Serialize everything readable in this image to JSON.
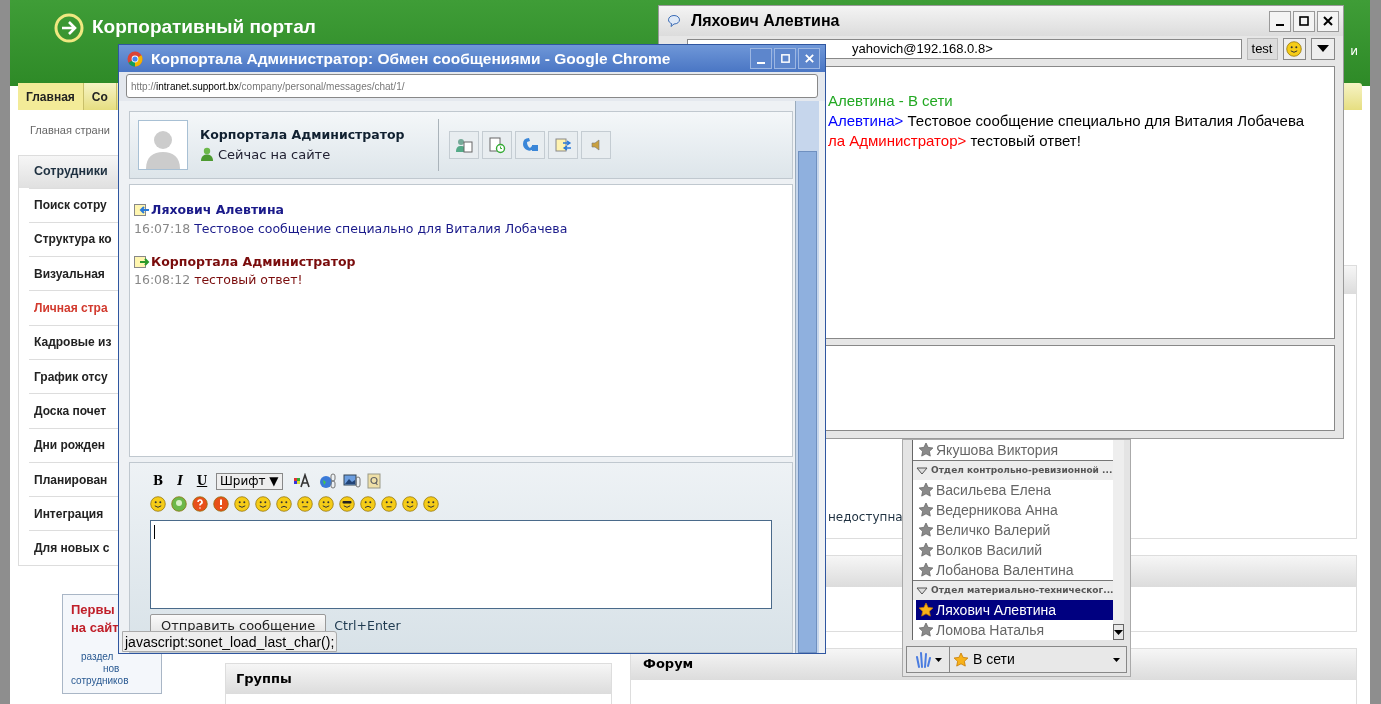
{
  "portal": {
    "title": "Корпоративный портал",
    "top_right_fragment": "и",
    "nav": [
      {
        "label": "Главная",
        "selected": true
      },
      {
        "label": "Со",
        "selected": false
      }
    ],
    "breadcrumb": "Главная страни",
    "sidebar": {
      "title": "Сотрудники",
      "items": [
        {
          "label": "Поиск сотру",
          "selected": false
        },
        {
          "label": "Структура ко",
          "selected": false
        },
        {
          "label": "Визуальная",
          "selected": false
        },
        {
          "label": "Личная стра",
          "selected": true
        },
        {
          "label": "Кадровые из",
          "selected": false
        },
        {
          "label": "График отсу",
          "selected": false
        },
        {
          "label": "Доска почет",
          "selected": false
        },
        {
          "label": "Дни рожден",
          "selected": false
        },
        {
          "label": "Планирован",
          "selected": false
        },
        {
          "label": "Интеграция",
          "selected": false
        },
        {
          "label": "Для новых с",
          "selected": false
        }
      ]
    },
    "banner": {
      "title_lines": [
        "Первы",
        "на сайт"
      ],
      "link_lines": [
        "раздел",
        "нов",
        "сотрудников"
      ]
    },
    "panels": {
      "groups": "Группы",
      "forum": "Форум",
      "status_fragment": "недоступна"
    }
  },
  "chat_window": {
    "title": "Корпортала Администратор: Обмен сообщениями - Google Chrome",
    "url": {
      "scheme": "http://",
      "host": "intranet.support.bx",
      "path": "/company/personal/messages/chat/1/"
    },
    "contact": {
      "name": "Корпортала Администратор",
      "status": "Сейчас на сайте"
    },
    "messages": [
      {
        "kind": "in",
        "author": "Ляхович Алевтина",
        "time": "16:07:18",
        "text": "Тестовое сообщение специально для Виталия Лобачева"
      },
      {
        "kind": "out",
        "author": "Корпортала Администратор",
        "time": "16:08:12",
        "text": "тестовый ответ!"
      }
    ],
    "format_buttons": [
      "B",
      "I",
      "U"
    ],
    "font_select": "Шрифт ▼",
    "send_button": "Отправить сообщение",
    "send_hint": "Ctrl+Enter",
    "status_bubble": "javascript:sonet_load_last_char();"
  },
  "im_window": {
    "title": "Ляхович Алевтина",
    "recipient": "yahovich@192.168.0.8>",
    "account_button": "test",
    "log": [
      {
        "color": "#22a822",
        "text": "Алевтина - В сети"
      },
      {
        "color": "#0000ff",
        "sender": "Алевтина>",
        "text": "Тестовое сообщение специально для Виталия Лобачева"
      },
      {
        "color": "#ff0000",
        "sender": "ла Администратор>",
        "text": "тестовый ответ!"
      }
    ]
  },
  "roster": {
    "items": [
      {
        "kind": "contact",
        "name": "Якушова Виктория",
        "online": false,
        "selected": false
      },
      {
        "kind": "group",
        "name": "Отдел контрольно-ревизионной ...",
        "expanded": true
      },
      {
        "kind": "contact",
        "name": "Васильева Елена",
        "online": false,
        "selected": false
      },
      {
        "kind": "contact",
        "name": "Ведерникова Анна",
        "online": false,
        "selected": false
      },
      {
        "kind": "contact",
        "name": "Величко Валерий",
        "online": false,
        "selected": false
      },
      {
        "kind": "contact",
        "name": "Волков Василий",
        "online": false,
        "selected": false
      },
      {
        "kind": "contact",
        "name": "Лобанова Валентина",
        "online": false,
        "selected": false
      },
      {
        "kind": "group",
        "name": "Отдел материально-техническог...",
        "expanded": true
      },
      {
        "kind": "contact",
        "name": "Ляхович Алевтина",
        "online": true,
        "selected": true
      },
      {
        "kind": "contact",
        "name": "Ломова Наталья",
        "online": false,
        "selected": false
      }
    ],
    "status": {
      "label": "В сети",
      "online": true
    }
  }
}
